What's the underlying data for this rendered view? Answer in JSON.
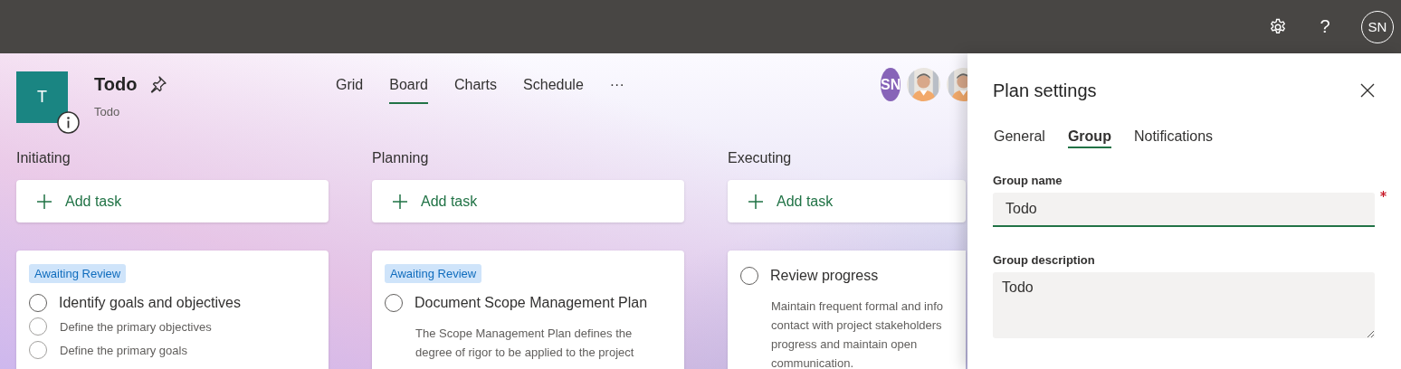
{
  "top_bar": {
    "help": "?",
    "user_initials": "SN"
  },
  "plan": {
    "logo_letter": "T",
    "title": "Todo",
    "subtitle": "Todo"
  },
  "views": [
    {
      "label": "Grid",
      "selected": false
    },
    {
      "label": "Board",
      "selected": true
    },
    {
      "label": "Charts",
      "selected": false
    },
    {
      "label": "Schedule",
      "selected": false
    }
  ],
  "more": "···",
  "members": [
    {
      "kind": "initials",
      "initials": "SN",
      "color": "#8764b8"
    },
    {
      "kind": "picture"
    },
    {
      "kind": "picture"
    }
  ],
  "buckets": [
    {
      "name": "Initiating",
      "add_task": "Add task",
      "tasks": [
        {
          "label": "Awaiting Review",
          "completed": false,
          "title": "Identify goals and objectives",
          "checklist": [
            {
              "text": "Define the primary objectives",
              "checked": false
            },
            {
              "text": "Define the primary goals",
              "checked": false
            }
          ]
        }
      ]
    },
    {
      "name": "Planning",
      "add_task": "Add task",
      "tasks": [
        {
          "label": "Awaiting Review",
          "completed": false,
          "title": "Document Scope Management Plan",
          "description": [
            "The Scope Management Plan defines the",
            "degree of rigor to be applied to the project"
          ]
        }
      ]
    },
    {
      "name": "Executing",
      "add_task": "Add task",
      "tasks": [
        {
          "completed": false,
          "title": "Review progress",
          "description": [
            "Maintain frequent formal and info",
            "contact with project stakeholders",
            "progress and maintain open",
            "communication."
          ]
        }
      ]
    }
  ],
  "panel": {
    "title": "Plan settings",
    "tabs": [
      {
        "label": "General",
        "selected": false
      },
      {
        "label": "Group",
        "selected": true
      },
      {
        "label": "Notifications",
        "selected": false
      }
    ],
    "fields": [
      {
        "kind": "input",
        "label": "Group name",
        "value": "Todo",
        "required": true
      },
      {
        "kind": "textarea",
        "label": "Group description",
        "value": "Todo",
        "required": false
      }
    ]
  }
}
